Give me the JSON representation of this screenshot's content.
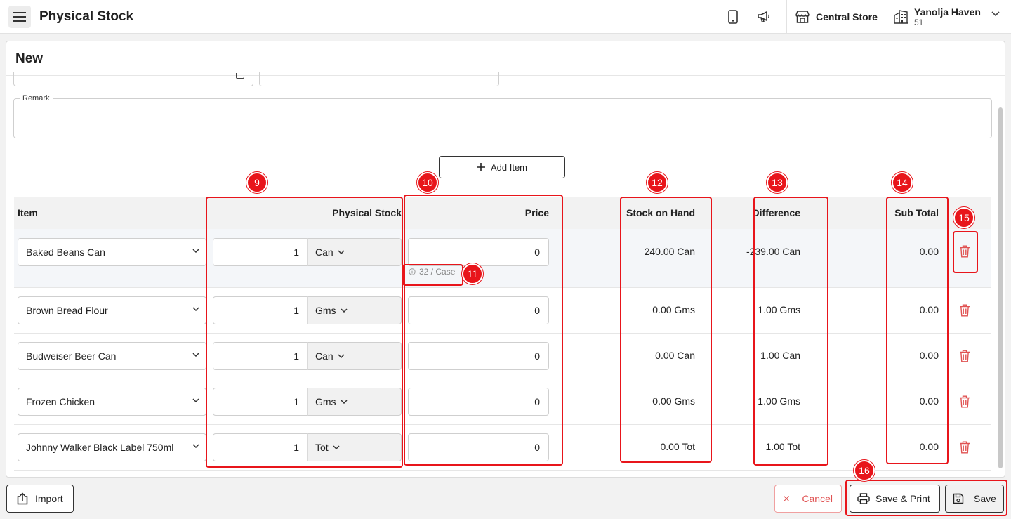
{
  "header": {
    "title": "Physical Stock",
    "store_label": "Central Store",
    "user_name": "Yanolja Haven",
    "user_id": "51"
  },
  "panel": {
    "title": "New",
    "remark_label": "Remark",
    "add_item_label": "Add Item"
  },
  "table": {
    "columns": {
      "item": "Item",
      "physical_stock": "Physical Stock",
      "price": "Price",
      "stock_on_hand": "Stock on Hand",
      "difference": "Difference",
      "sub_total": "Sub Total"
    },
    "rows": [
      {
        "item": "Baked Beans Can",
        "qty": "1",
        "unit": "Can",
        "price": "0",
        "hint": "32 / Case",
        "stock_on_hand": "240.00 Can",
        "difference": "-239.00 Can",
        "sub_total": "0.00"
      },
      {
        "item": "Brown Bread Flour",
        "qty": "1",
        "unit": "Gms",
        "price": "0",
        "stock_on_hand": "0.00 Gms",
        "difference": "1.00 Gms",
        "sub_total": "0.00"
      },
      {
        "item": "Budweiser Beer Can",
        "qty": "1",
        "unit": "Can",
        "price": "0",
        "stock_on_hand": "0.00 Can",
        "difference": "1.00 Can",
        "sub_total": "0.00"
      },
      {
        "item": "Frozen Chicken",
        "qty": "1",
        "unit": "Gms",
        "price": "0",
        "stock_on_hand": "0.00 Gms",
        "difference": "1.00 Gms",
        "sub_total": "0.00"
      },
      {
        "item": "Johnny Walker Black Label 750ml",
        "qty": "1",
        "unit": "Tot",
        "price": "0",
        "stock_on_hand": "0.00 Tot",
        "difference": "1.00 Tot",
        "sub_total": "0.00"
      }
    ]
  },
  "footer": {
    "import_label": "Import",
    "cancel_label": "Cancel",
    "save_print_label": "Save & Print",
    "save_label": "Save"
  },
  "annotations": {
    "badge_9": "9",
    "badge_10": "10",
    "badge_11": "11",
    "badge_12": "12",
    "badge_13": "13",
    "badge_14": "14",
    "badge_15": "15",
    "badge_16": "16"
  },
  "colors": {
    "annotation": "#e8151b",
    "delete_icon": "#e05252",
    "cancel_text": "#e05252"
  },
  "icons": [
    "hamburger-menu-icon",
    "mobile-icon",
    "megaphone-icon",
    "store-icon",
    "building-icon",
    "chevron-down-icon",
    "plus-icon",
    "info-icon",
    "trash-icon",
    "import-icon",
    "close-icon",
    "printer-icon",
    "save-icon"
  ]
}
